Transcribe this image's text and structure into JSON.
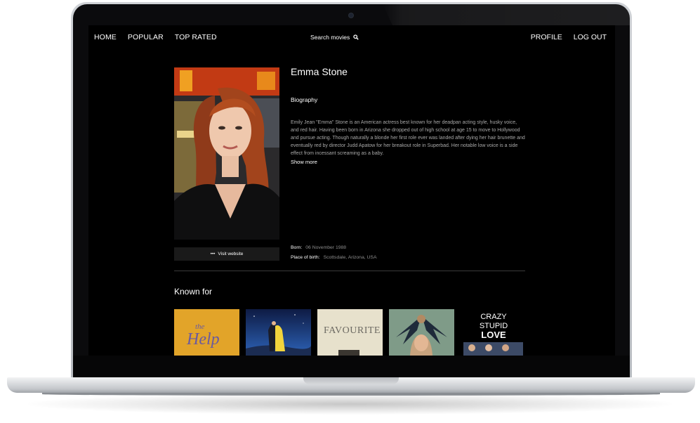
{
  "nav": {
    "left": [
      "HOME",
      "POPULAR",
      "TOP RATED"
    ],
    "search_label": "Search movies",
    "right": [
      "PROFILE",
      "LOG OUT"
    ]
  },
  "person": {
    "name": "Emma Stone",
    "biography_title": "Biography",
    "biography": "Emily Jean \"Emma\" Stone is an American actress best known for her deadpan acting style, husky voice, and red hair. Having been born in Arizona she dropped out of high school at age 15 to move to Hollywood and pursue acting. Though naturally a blonde her first role ever was landed after dying her hair brunette and eventually red by director Judd Apatow for her breakout role in Superbad. Her notable low voice is a side effect from incessant screaming as a baby.",
    "show_more": "Show more",
    "visit_website": "Visit website",
    "born_label": "Born:",
    "born_value": "06 November 1988",
    "birthplace_label": "Place of birth:",
    "birthplace_value": "Scottsdale, Arizona, USA"
  },
  "known_for": {
    "title": "Known for",
    "posters": [
      {
        "name": "the-help",
        "text": "the Help"
      },
      {
        "name": "la-la-land",
        "text": ""
      },
      {
        "name": "the-favourite",
        "text": "FAVOURITE"
      },
      {
        "name": "birdman",
        "text": ""
      },
      {
        "name": "crazy-stupid-love",
        "text": "CRAZY STUPID LOVE"
      }
    ]
  },
  "colors": {
    "page_bg": "#000000",
    "text": "#ffffff",
    "muted_text": "#a9a9a9",
    "button_bg": "#1a1a1a"
  }
}
